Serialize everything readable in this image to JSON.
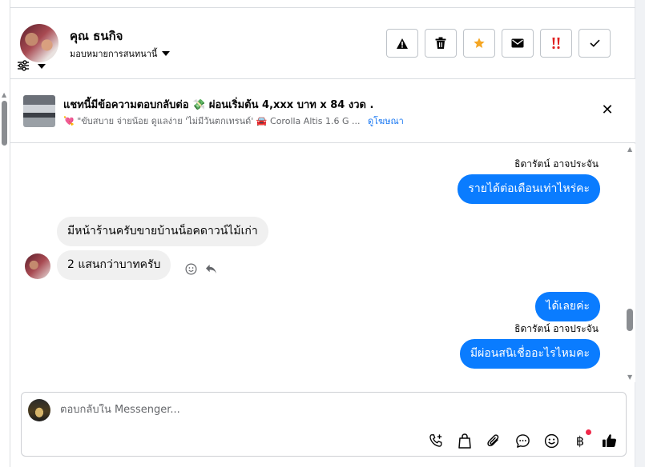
{
  "header": {
    "contact_name": "คุณ ธนกิจ",
    "assign_label": "มอบหมายการสนทนานี้",
    "actions": [
      {
        "name": "report-button",
        "icon": "warning-icon"
      },
      {
        "name": "delete-button",
        "icon": "trash-icon"
      },
      {
        "name": "star-button",
        "icon": "star-icon"
      },
      {
        "name": "mark-unread-button",
        "icon": "envelope-icon"
      },
      {
        "name": "follow-up-button",
        "icon": "double-exclamation-icon"
      },
      {
        "name": "mark-done-button",
        "icon": "check-icon"
      }
    ],
    "colors": {
      "star": "#f5a623",
      "follow_up": "#e02020"
    }
  },
  "banner": {
    "title": "แชทนี้มีข้อความตอบกลับต่อ 💸 ผ่อนเริ่มต้น 4,xxx บาท x 84 งวด .",
    "subtitle": "💘 \"ขับสบาย จ่ายน้อย ดูแลง่าย 'ไม่มีวันตกเทรนด์' 🚘 Corolla Altis 1.6 G ...",
    "link": "ดูโฆษณา"
  },
  "messages": {
    "sender_1": "ธิดารัตน์ อาจประจัน",
    "out_1": "รายได้ต่อเดือนเท่าไหร่คะ",
    "in_1": "มีหน้าร้านครับขายบ้านน็อคดาวน์ไม้เก่า",
    "in_2": "2 แสนกว่าบาทครับ",
    "out_2": "ได้เลยค่ะ",
    "sender_2": "ธิดารัตน์ อาจประจัน",
    "out_3": "มีผ่อนสนิเชื่ออะไรไหมคะ"
  },
  "composer": {
    "placeholder": "ตอบกลับใน Messenger..."
  },
  "accent": "#0a7cff"
}
